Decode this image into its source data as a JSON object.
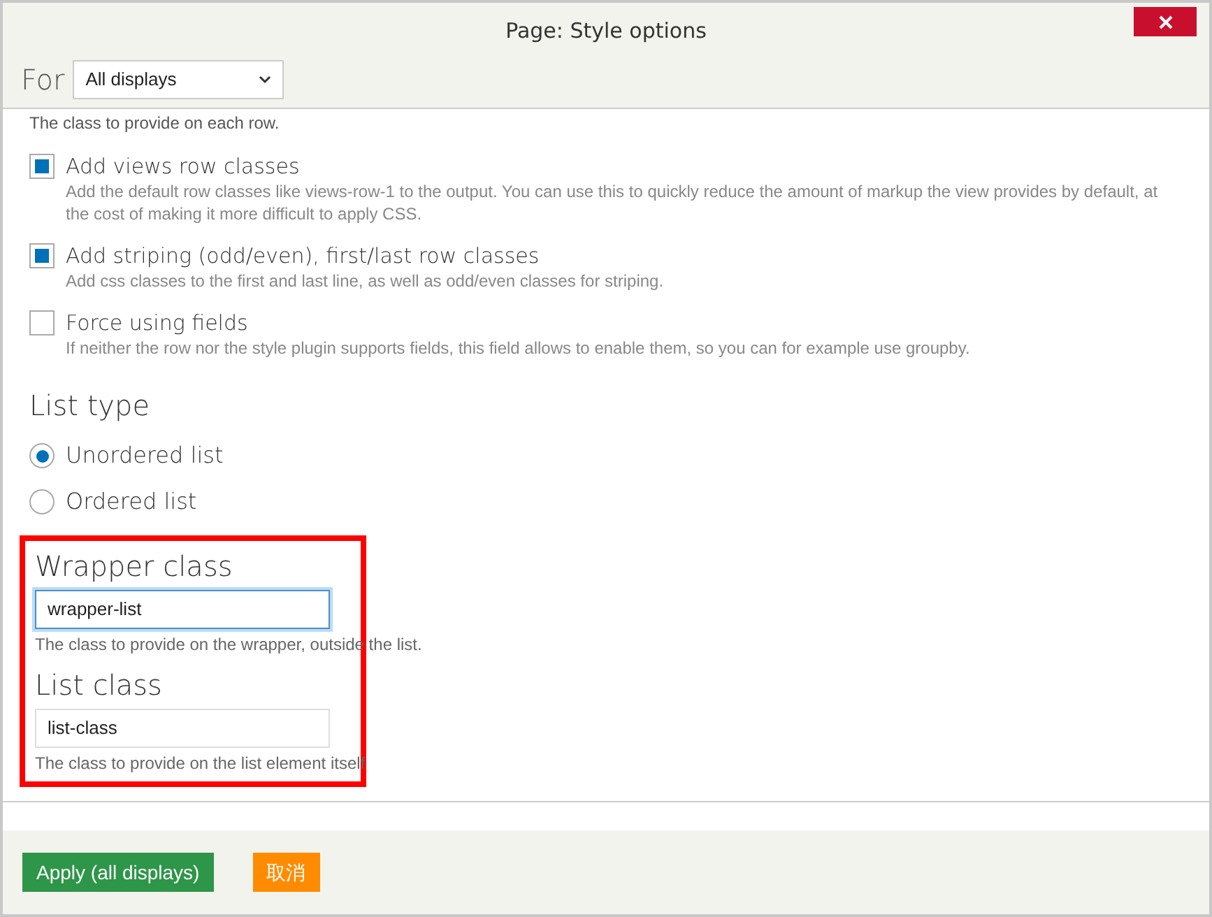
{
  "dialog": {
    "title": "Page: Style options"
  },
  "for_selector": {
    "label": "For",
    "value": "All displays"
  },
  "intro_description": "The class to provide on each row.",
  "checkboxes": [
    {
      "label": "Add views row classes",
      "checked": true,
      "description": "Add the default row classes like views-row-1 to the output. You can use this to quickly reduce the amount of markup the view provides by default, at the cost of making it more difficult to apply CSS."
    },
    {
      "label": "Add striping (odd/even), first/last row classes",
      "checked": true,
      "description": "Add css classes to the first and last line, as well as odd/even classes for striping."
    },
    {
      "label": "Force using fields",
      "checked": false,
      "description": "If neither the row nor the style plugin supports fields, this field allows to enable them, so you can for example use groupby."
    }
  ],
  "list_type": {
    "heading": "List type",
    "options": [
      {
        "label": "Unordered list",
        "selected": true
      },
      {
        "label": "Ordered list",
        "selected": false
      }
    ]
  },
  "highlighted_fields": {
    "highlighted": true,
    "fields": [
      {
        "heading": "Wrapper class",
        "value": "wrapper-list",
        "focused": true,
        "description": "The class to provide on the wrapper, outside the list."
      },
      {
        "heading": "List class",
        "value": "list-class",
        "focused": false,
        "description": "The class to provide on the list element itself"
      }
    ]
  },
  "buttons": [
    {
      "label": "Apply (all displays)",
      "kind": "primary"
    },
    {
      "label": "取消",
      "kind": "cancel"
    }
  ]
}
